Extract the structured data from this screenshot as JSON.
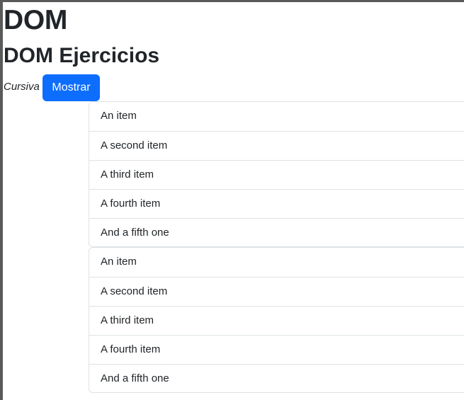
{
  "heading": "DOM",
  "subheading": "DOM Ejercicios",
  "italic_text": "Cursiva",
  "button_label": "Mostrar",
  "accent_color": "#0d6efd",
  "lists": [
    {
      "items": [
        "An item",
        "A second item",
        "A third item",
        "A fourth item",
        "And a fifth one"
      ]
    },
    {
      "items": [
        "An item",
        "A second item",
        "A third item",
        "A fourth item",
        "And a fifth one"
      ]
    }
  ]
}
